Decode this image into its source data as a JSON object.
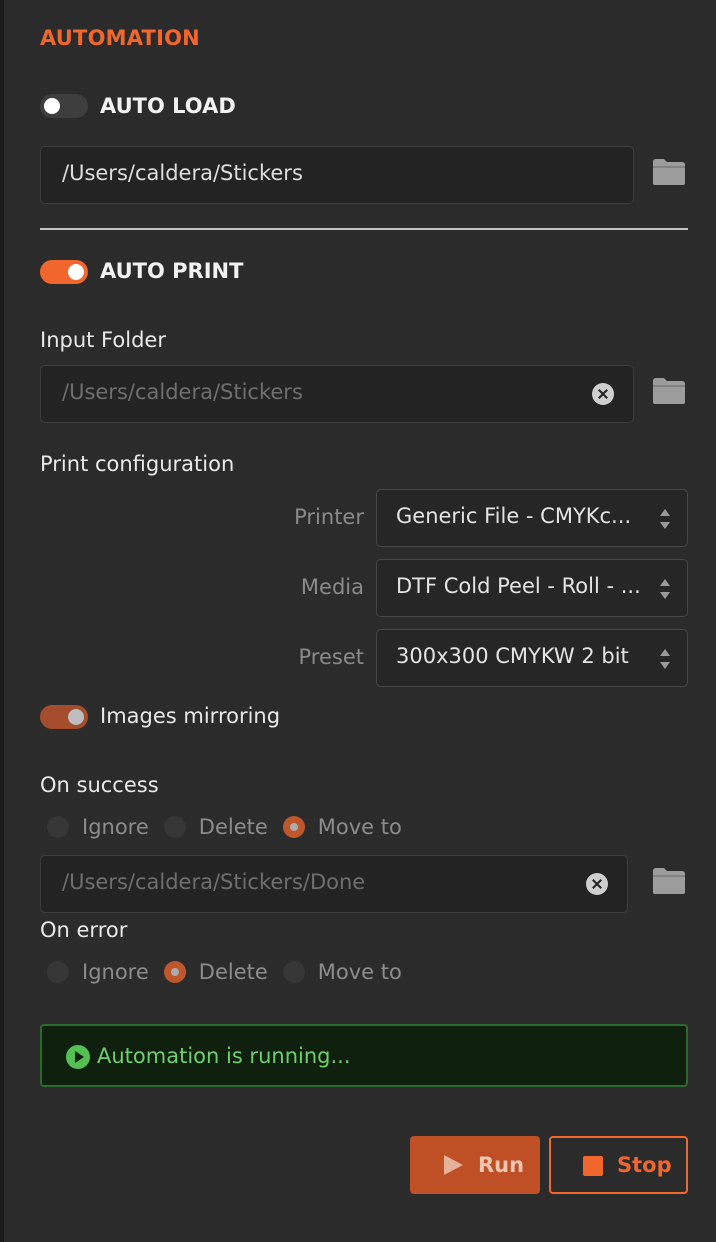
{
  "section": {
    "title": "AUTOMATION"
  },
  "auto_load": {
    "label": "AUTO LOAD",
    "enabled": false,
    "path": "/Users/caldera/Stickers",
    "icon": "folder-icon"
  },
  "auto_print": {
    "label": "AUTO PRINT",
    "enabled": true,
    "input_folder": {
      "label": "Input Folder",
      "placeholder": "/Users/caldera/Stickers",
      "icon": "folder-icon"
    },
    "print_configuration": {
      "label": "Print configuration",
      "printer": {
        "label": "Printer",
        "value": "Generic File - CMYKc..."
      },
      "media": {
        "label": "Media",
        "value": "DTF Cold Peel - Roll - ..."
      },
      "preset": {
        "label": "Preset",
        "value": "300x300 CMYKW 2 bit"
      }
    },
    "images_mirroring": {
      "label": "Images mirroring",
      "enabled": true
    },
    "on_success": {
      "label": "On success",
      "options": [
        "Ignore",
        "Delete",
        "Move to"
      ],
      "selected": "Move to",
      "move_to_placeholder": "/Users/caldera/Stickers/Done"
    },
    "on_error": {
      "label": "On error",
      "options": [
        "Ignore",
        "Delete",
        "Move to"
      ],
      "selected": "Delete"
    }
  },
  "status": {
    "text": "Automation is running...",
    "color": "#6fcf6f"
  },
  "buttons": {
    "run_label": "Run",
    "stop_label": "Stop"
  },
  "colors": {
    "accent": "#f0662d",
    "background": "#2b2b2b",
    "status_bg": "#0f200f"
  }
}
